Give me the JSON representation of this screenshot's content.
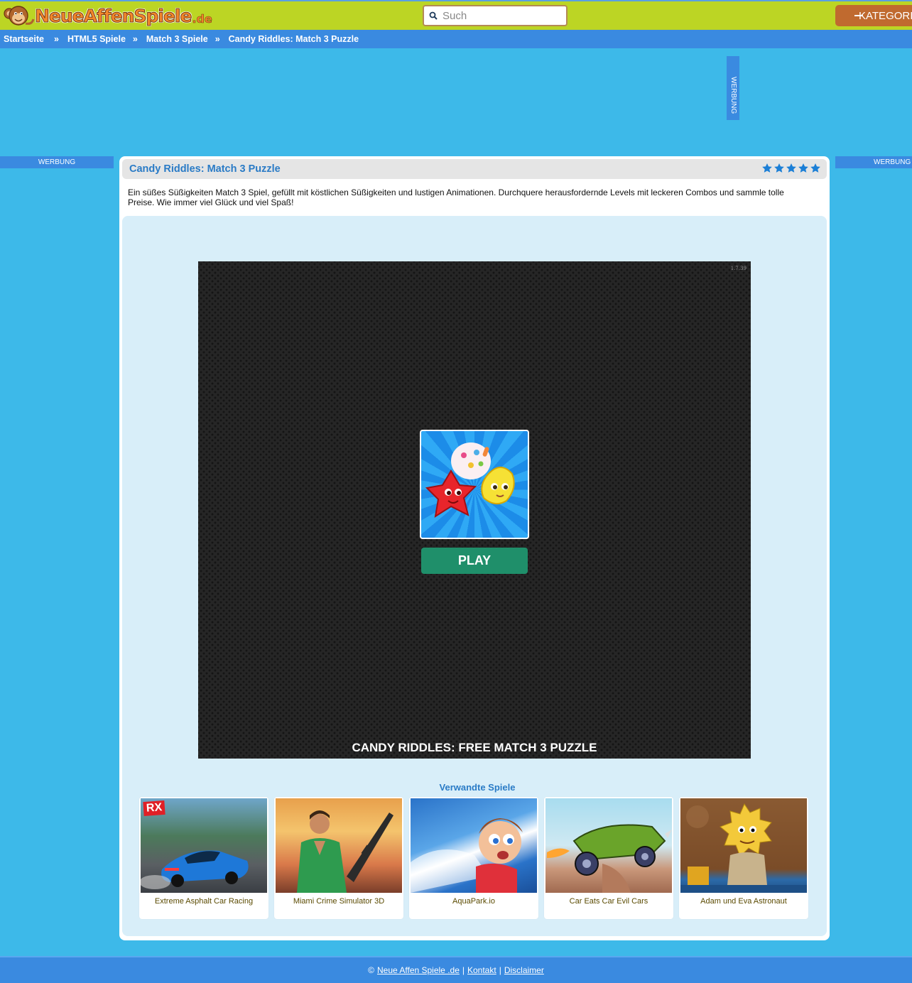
{
  "header": {
    "logo_text": "NeueAffenSpiele",
    "logo_tld": ".de",
    "search_placeholder": "Such",
    "categories_label": "KATEGORIEN"
  },
  "breadcrumb": {
    "items": [
      "Startseite",
      "HTML5 Spiele",
      "Match 3 Spiele",
      "Candy Riddles: Match 3 Puzzle"
    ],
    "separator": "»"
  },
  "ads": {
    "label": "WERBUNG"
  },
  "game": {
    "title": "Candy Riddles: Match 3 Puzzle",
    "rating_stars": 5,
    "description": "Ein süßes Süßigkeiten Match 3 Spiel, gefüllt mit köstlichen Süßigkeiten und lustigen Animationen. Durchquere herausfordernde Levels mit leckeren Combos und sammle tolle Preise. Wie immer viel Glück und viel Spaß!",
    "version": "1.7.39",
    "play_label": "PLAY",
    "canvas_title": "CANDY RIDDLES: FREE MATCH 3 PUZZLE"
  },
  "related": {
    "title": "Verwandte Spiele",
    "items": [
      {
        "name": "Extreme Asphalt Car Racing",
        "badge": "RX"
      },
      {
        "name": "Miami Crime Simulator 3D"
      },
      {
        "name": "AquaPark.io"
      },
      {
        "name": "Car Eats Car Evil Cars"
      },
      {
        "name": "Adam und Eva Astronaut"
      }
    ]
  },
  "footer": {
    "copyright": "©",
    "site_link": "Neue Affen Spiele .de",
    "contact_link": "Kontakt",
    "disclaimer_link": "Disclaimer"
  },
  "colors": {
    "page_bg": "#3db9e9",
    "topbar": "#bcd524",
    "nav_blue": "#3a8ae0",
    "title_blue": "#2a7bc6",
    "play_green": "#1f8f6a",
    "category_brown": "#c06a2f"
  }
}
